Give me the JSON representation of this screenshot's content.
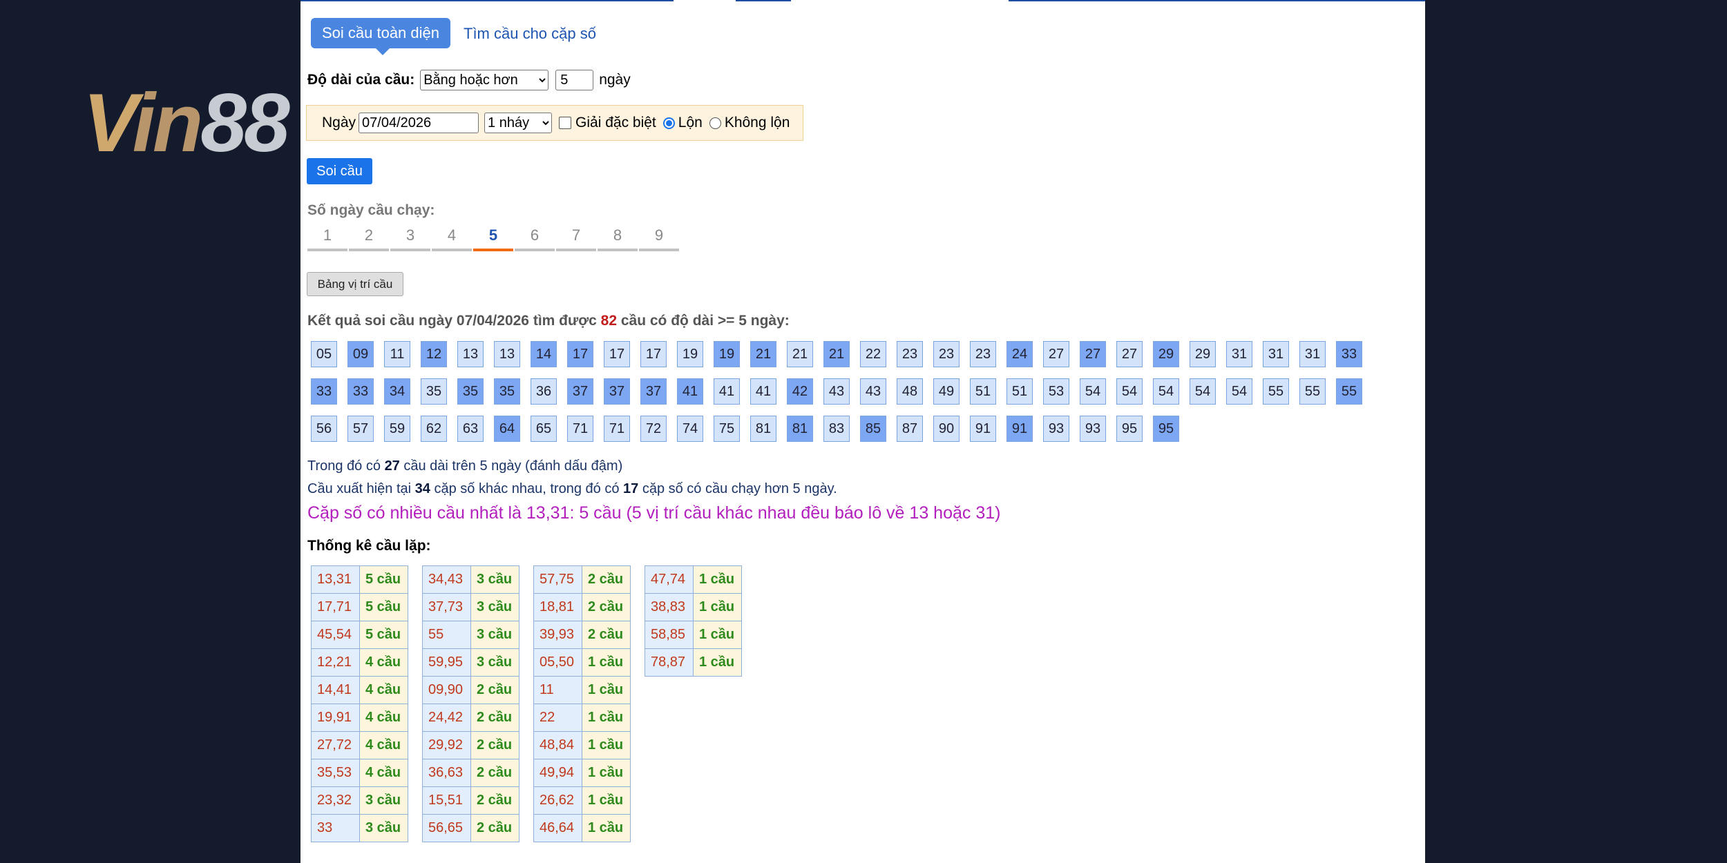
{
  "logo": {
    "text_v": "V",
    "text_in": "in",
    "text_88": "88"
  },
  "tabs": {
    "active": "Soi cầu toàn diện",
    "other": "Tìm cầu cho cặp số"
  },
  "length": {
    "label": "Độ dài của cầu:",
    "select_value": "Bằng hoặc hơn",
    "days_value": "5",
    "unit": "ngày"
  },
  "filter": {
    "date_label": "Ngày",
    "date_value": "07/04/2026",
    "nhay_value": "1 nháy",
    "special_label": "Giải đặc biệt",
    "lon_label": "Lộn",
    "khong_lon_label": "Không lộn"
  },
  "buttons": {
    "soi_cau": "Soi cầu",
    "bang_vi_tri": "Bảng vị trí cầu"
  },
  "days": {
    "label": "Số ngày cầu chạy:",
    "items": [
      "1",
      "2",
      "3",
      "4",
      "5",
      "6",
      "7",
      "8",
      "9"
    ],
    "active": "5"
  },
  "result": {
    "prefix": "Kết quả soi cầu ngày 07/04/2026 tìm được",
    "count": "82",
    "suffix": "cầu có độ dài >= 5 ngày:"
  },
  "numbers": [
    {
      "v": "05",
      "d": false
    },
    {
      "v": "09",
      "d": true
    },
    {
      "v": "11",
      "d": false
    },
    {
      "v": "12",
      "d": true
    },
    {
      "v": "13",
      "d": false
    },
    {
      "v": "13",
      "d": false
    },
    {
      "v": "14",
      "d": true
    },
    {
      "v": "17",
      "d": true
    },
    {
      "v": "17",
      "d": false
    },
    {
      "v": "17",
      "d": false
    },
    {
      "v": "19",
      "d": false
    },
    {
      "v": "19",
      "d": true
    },
    {
      "v": "21",
      "d": true
    },
    {
      "v": "21",
      "d": false
    },
    {
      "v": "21",
      "d": true
    },
    {
      "v": "22",
      "d": false
    },
    {
      "v": "23",
      "d": false
    },
    {
      "v": "23",
      "d": false
    },
    {
      "v": "23",
      "d": false
    },
    {
      "v": "24",
      "d": true
    },
    {
      "v": "27",
      "d": false
    },
    {
      "v": "27",
      "d": true
    },
    {
      "v": "27",
      "d": false
    },
    {
      "v": "29",
      "d": true
    },
    {
      "v": "29",
      "d": false
    },
    {
      "v": "31",
      "d": false
    },
    {
      "v": "31",
      "d": false
    },
    {
      "v": "31",
      "d": false
    },
    {
      "v": "33",
      "d": true
    },
    {
      "v": "33",
      "d": true
    },
    {
      "v": "33",
      "d": true
    },
    {
      "v": "34",
      "d": true
    },
    {
      "v": "35",
      "d": false
    },
    {
      "v": "35",
      "d": true
    },
    {
      "v": "35",
      "d": true
    },
    {
      "v": "36",
      "d": false
    },
    {
      "v": "37",
      "d": true
    },
    {
      "v": "37",
      "d": true
    },
    {
      "v": "37",
      "d": true
    },
    {
      "v": "41",
      "d": true
    },
    {
      "v": "41",
      "d": false
    },
    {
      "v": "41",
      "d": false
    },
    {
      "v": "42",
      "d": true
    },
    {
      "v": "43",
      "d": false
    },
    {
      "v": "43",
      "d": false
    },
    {
      "v": "48",
      "d": false
    },
    {
      "v": "49",
      "d": false
    },
    {
      "v": "51",
      "d": false
    },
    {
      "v": "51",
      "d": false
    },
    {
      "v": "53",
      "d": false
    },
    {
      "v": "54",
      "d": false
    },
    {
      "v": "54",
      "d": false
    },
    {
      "v": "54",
      "d": false
    },
    {
      "v": "54",
      "d": false
    },
    {
      "v": "54",
      "d": false
    },
    {
      "v": "55",
      "d": false
    },
    {
      "v": "55",
      "d": false
    },
    {
      "v": "55",
      "d": true
    },
    {
      "v": "56",
      "d": false
    },
    {
      "v": "57",
      "d": false
    },
    {
      "v": "59",
      "d": false
    },
    {
      "v": "62",
      "d": false
    },
    {
      "v": "63",
      "d": false
    },
    {
      "v": "64",
      "d": true
    },
    {
      "v": "65",
      "d": false
    },
    {
      "v": "71",
      "d": false
    },
    {
      "v": "71",
      "d": false
    },
    {
      "v": "72",
      "d": false
    },
    {
      "v": "74",
      "d": false
    },
    {
      "v": "75",
      "d": false
    },
    {
      "v": "81",
      "d": false
    },
    {
      "v": "81",
      "d": true
    },
    {
      "v": "83",
      "d": false
    },
    {
      "v": "85",
      "d": true
    },
    {
      "v": "87",
      "d": false
    },
    {
      "v": "90",
      "d": false
    },
    {
      "v": "91",
      "d": false
    },
    {
      "v": "91",
      "d": true
    },
    {
      "v": "93",
      "d": false
    },
    {
      "v": "93",
      "d": false
    },
    {
      "v": "95",
      "d": false
    },
    {
      "v": "95",
      "d": true
    }
  ],
  "info": {
    "l1_a": "Trong đó có",
    "l1_b": "27",
    "l1_c": "cầu dài trên 5 ngày (đánh dấu đậm)",
    "l2_a": "Cầu xuất hiện tại",
    "l2_b": "34",
    "l2_c": "cặp số khác nhau, trong đó có",
    "l2_d": "17",
    "l2_e": "cặp số có cầu chạy hơn 5 ngày."
  },
  "summary": "Cặp số có nhiều cầu nhất là 13,31: 5 cầu (5 vị trí cầu khác nhau đều báo lô về 13 hoặc 31)",
  "stats_title": "Thống kê cầu lặp:",
  "stats": [
    [
      [
        "13,31",
        "5 cầu"
      ],
      [
        "17,71",
        "5 cầu"
      ],
      [
        "45,54",
        "5 cầu"
      ],
      [
        "12,21",
        "4 cầu"
      ],
      [
        "14,41",
        "4 cầu"
      ],
      [
        "19,91",
        "4 cầu"
      ],
      [
        "27,72",
        "4 cầu"
      ],
      [
        "35,53",
        "4 cầu"
      ],
      [
        "23,32",
        "3 cầu"
      ],
      [
        "33",
        "3 cầu"
      ]
    ],
    [
      [
        "34,43",
        "3 cầu"
      ],
      [
        "37,73",
        "3 cầu"
      ],
      [
        "55",
        "3 cầu"
      ],
      [
        "59,95",
        "3 cầu"
      ],
      [
        "09,90",
        "2 cầu"
      ],
      [
        "24,42",
        "2 cầu"
      ],
      [
        "29,92",
        "2 cầu"
      ],
      [
        "36,63",
        "2 cầu"
      ],
      [
        "15,51",
        "2 cầu"
      ],
      [
        "56,65",
        "2 cầu"
      ]
    ],
    [
      [
        "57,75",
        "2 cầu"
      ],
      [
        "18,81",
        "2 cầu"
      ],
      [
        "39,93",
        "2 cầu"
      ],
      [
        "05,50",
        "1 cầu"
      ],
      [
        "11",
        "1 cầu"
      ],
      [
        "22",
        "1 cầu"
      ],
      [
        "48,84",
        "1 cầu"
      ],
      [
        "49,94",
        "1 cầu"
      ],
      [
        "26,62",
        "1 cầu"
      ],
      [
        "46,64",
        "1 cầu"
      ]
    ],
    [
      [
        "47,74",
        "1 cầu"
      ],
      [
        "38,83",
        "1 cầu"
      ],
      [
        "58,85",
        "1 cầu"
      ],
      [
        "78,87",
        "1 cầu"
      ]
    ]
  ]
}
